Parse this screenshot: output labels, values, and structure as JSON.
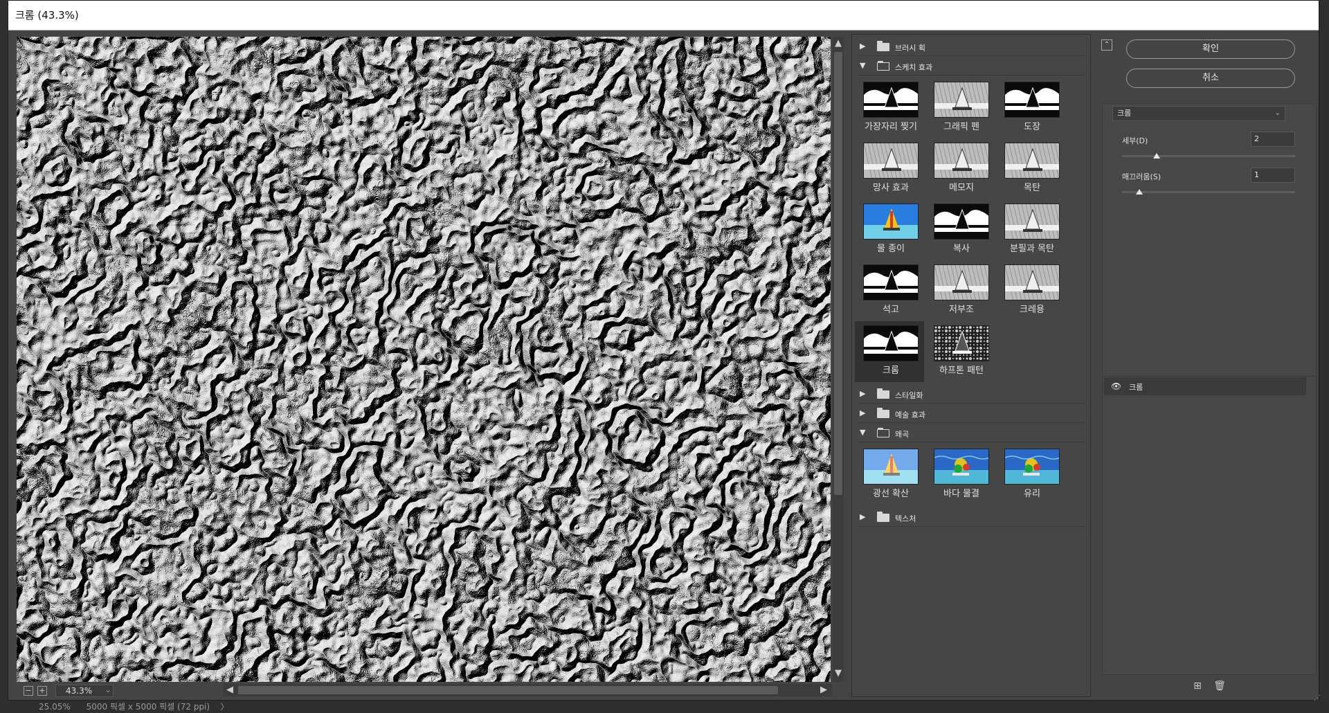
{
  "dialog": {
    "title": "크롬 (43.3%)",
    "zoom_value": "43.3%",
    "zoom_minus": "−",
    "zoom_plus": "+"
  },
  "status_bar": {
    "text": "25.05%      5000 픽셀 x 5000 픽셀 (72 ppi)    〉"
  },
  "scroll": {
    "up": "▲",
    "down": "▼",
    "left": "◀",
    "right": "▶"
  },
  "gallery": {
    "categories": [
      {
        "label": "브러시 획",
        "expanded": false
      },
      {
        "label": "스케치 효과",
        "expanded": true,
        "filters": [
          {
            "label": "가장자리 찢기",
            "style": "torn"
          },
          {
            "label": "그래픽 펜",
            "style": "pen"
          },
          {
            "label": "도장",
            "style": "stamp"
          },
          {
            "label": "망사 효과",
            "style": "reticulation"
          },
          {
            "label": "메모지",
            "style": "notepaper"
          },
          {
            "label": "목탄",
            "style": "charcoal"
          },
          {
            "label": "물 종이",
            "style": "color"
          },
          {
            "label": "복사",
            "style": "photocopy"
          },
          {
            "label": "분필과 목탄",
            "style": "chalk"
          },
          {
            "label": "석고",
            "style": "plaster"
          },
          {
            "label": "저부조",
            "style": "basrelief"
          },
          {
            "label": "크레용",
            "style": "conte"
          },
          {
            "label": "크롬",
            "style": "chrome",
            "selected": true
          },
          {
            "label": "하프톤 패턴",
            "style": "halftone"
          }
        ]
      },
      {
        "label": "스타일화",
        "expanded": false
      },
      {
        "label": "예술 효과",
        "expanded": false
      },
      {
        "label": "왜곡",
        "expanded": true,
        "filters": [
          {
            "label": "광선 확산",
            "style": "glow"
          },
          {
            "label": "바다 물결",
            "style": "ocean"
          },
          {
            "label": "유리",
            "style": "glass"
          }
        ]
      },
      {
        "label": "텍스처",
        "expanded": false
      }
    ]
  },
  "panel": {
    "collapse_icon": "⌃",
    "ok_label": "확인",
    "cancel_label": "취소",
    "filter_select": "크롬",
    "select_chevron": "⌄",
    "params": [
      {
        "label": "세부(D)",
        "value": "2",
        "level": 0.2
      },
      {
        "label": "매끄러움(S)",
        "value": "1",
        "level": 0.1
      }
    ]
  },
  "layers": {
    "visibility_icon": "👁",
    "items": [
      {
        "name": "크롬"
      }
    ],
    "new_layer_icon": "⊞",
    "delete_icon": "🗑"
  },
  "colors": {
    "dialog_bg": "#444444",
    "preview_bg": "#111111",
    "selected_cell": "#313131"
  }
}
